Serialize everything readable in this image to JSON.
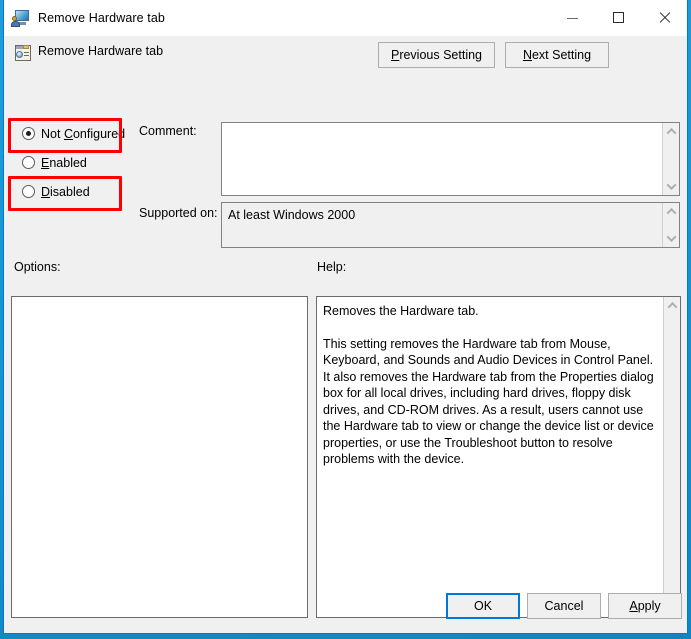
{
  "window": {
    "title": "Remove Hardware tab",
    "title_icon": "computer-user-icon",
    "controls": {
      "minimize": "minimize-icon",
      "maximize": "maximize-icon",
      "close": "close-icon"
    }
  },
  "header": {
    "icon": "group-policy-setting-icon",
    "title": "Remove Hardware tab",
    "previous_setting_label": "Previous Setting",
    "previous_setting_accel": "P",
    "next_setting_label": "Next Setting",
    "next_setting_accel": "N"
  },
  "state": {
    "options": [
      {
        "label": "Not Configured",
        "accel": "C",
        "selected": true
      },
      {
        "label": "Enabled",
        "accel": "E",
        "selected": false
      },
      {
        "label": "Disabled",
        "accel": "D",
        "selected": false
      }
    ]
  },
  "annotations": {
    "color": "#ff0000",
    "boxes": [
      {
        "target": "Not Configured"
      },
      {
        "target": "Disabled"
      }
    ]
  },
  "comment": {
    "label": "Comment:",
    "value": "",
    "placeholder": ""
  },
  "supported_on": {
    "label": "Supported on:",
    "value": "At least Windows 2000"
  },
  "panels": {
    "options_label": "Options:",
    "options_content": "",
    "help_label": "Help:",
    "help_paragraph_1": "Removes the Hardware tab.",
    "help_paragraph_2": "This setting removes the Hardware tab from Mouse, Keyboard, and Sounds and Audio Devices in Control Panel. It also removes the Hardware tab from the Properties dialog box for all local drives, including hard drives, floppy disk drives, and CD-ROM drives. As a result, users cannot use the Hardware tab to view or change the device list or device properties, or use the Troubleshoot button to resolve problems with the device."
  },
  "buttons": {
    "ok": "OK",
    "cancel": "Cancel",
    "apply": "Apply",
    "apply_accel": "A"
  },
  "colors": {
    "accent": "#0078d7",
    "dialog_bg": "#f0f0f0",
    "field_bg": "#ffffff",
    "readonly_bg": "#f0f0f0",
    "annotation": "#ff0000"
  }
}
